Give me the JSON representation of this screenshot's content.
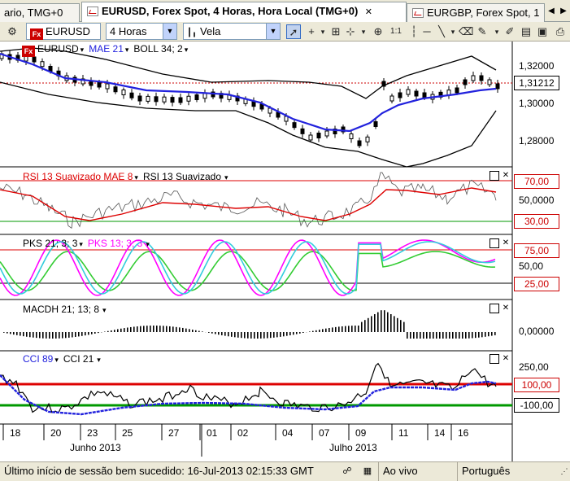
{
  "tabs": [
    {
      "label": "ario, TMG+0"
    },
    {
      "label": "EURUSD, Forex Spot, 4 Horas, Hora Local (TMG+0)"
    },
    {
      "label": "EURGBP, Forex Spot, 1"
    }
  ],
  "toolbar": {
    "instrument": "EURUSD",
    "instrument_badge": "Fx",
    "timeframe": "4 Horas",
    "chart_type": "Vela"
  },
  "panes": {
    "price": {
      "symbol": "EURUSD",
      "indicator1": "MAE 21",
      "indicator2": "BOLL 34; 2",
      "axis": [
        "1,32000",
        "1,30000",
        "1,28000"
      ],
      "current_price": "1,31212"
    },
    "rsi": {
      "label1": "RSI 13 Suavizado MAE 8",
      "label2": "RSI 13 Suavizado",
      "axis": [
        "70,00",
        "50,0000",
        "30,00"
      ]
    },
    "pks": {
      "label1": "PKS 21; 3; 3",
      "label2": "PKS 13; 3; 3",
      "axis": [
        "75,00",
        "50,00",
        "25,00"
      ]
    },
    "macd": {
      "label1": "MACDH 21; 13; 8",
      "axis": [
        "0,00000"
      ]
    },
    "cci": {
      "label1": "CCI 89",
      "label2": "CCI 21",
      "axis": [
        "250,00",
        "100,00",
        "-100,00"
      ]
    }
  },
  "time_axis": {
    "days": [
      "18",
      "20",
      "23",
      "25",
      "27",
      "01",
      "02",
      "04",
      "07",
      "09",
      "11",
      "14",
      "16"
    ],
    "months": [
      "Junho 2013",
      "Julho 2013"
    ]
  },
  "status": {
    "session": "Último início de sessão bem sucedido: 16-Jul-2013 02:15:33 GMT",
    "live": "Ao vivo",
    "language": "Português"
  },
  "colors": {
    "price_line": "#cc0000",
    "ma_blue": "#2222dd",
    "rsi_red": "#dd0000",
    "pks_magenta": "#ff00ff",
    "pks_cyan": "#33ccdd",
    "pks_green": "#33cc33",
    "cci_red": "#dd0000",
    "cci_green": "#009900"
  }
}
